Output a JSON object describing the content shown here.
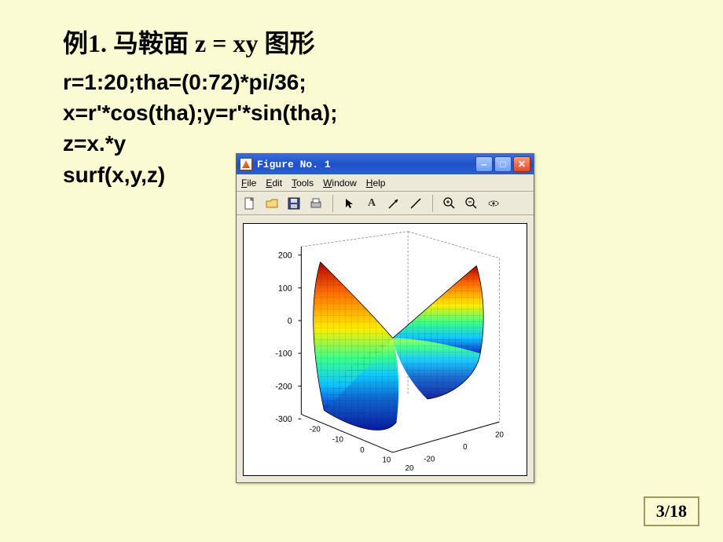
{
  "title": "例1. 马鞍面 z = xy 图形",
  "code": [
    "r=1:20;tha=(0:72)*pi/36;",
    "x=r'*cos(tha);y=r'*sin(tha);",
    "z=x.*y",
    "surf(x,y,z)"
  ],
  "figure": {
    "window_title": "Figure No. 1",
    "menus": {
      "file": "File",
      "edit": "Edit",
      "tools": "Tools",
      "window": "Window",
      "help": "Help"
    },
    "toolbar_icons": {
      "new": "new-file-icon",
      "open": "open-folder-icon",
      "save": "save-disk-icon",
      "print": "print-icon",
      "arrow": "pointer-arrow-icon",
      "text": "text-A-icon",
      "line_arrow": "arrow-icon",
      "line": "line-icon",
      "zoom_in": "zoom-in-icon",
      "zoom_out": "zoom-out-icon",
      "rotate": "rotate-3d-icon"
    },
    "z_ticks": [
      "200",
      "100",
      "0",
      "-100",
      "-200",
      "-300"
    ],
    "xy_ticks": [
      "-20",
      "-10",
      "0",
      "10",
      "20"
    ],
    "y_ticks_right": [
      "-20",
      "0",
      "20"
    ]
  },
  "page_number": "3/18",
  "chart_data": {
    "type": "surface-3d",
    "title": "",
    "equation": "z = x * y",
    "parameters": {
      "r_range": [
        1,
        20
      ],
      "theta_steps": 72,
      "theta_expr": "(0:72)*pi/36"
    },
    "axes": {
      "x": {
        "range": [
          -20,
          20
        ],
        "ticks": [
          -20,
          -10,
          0,
          10,
          20
        ]
      },
      "y": {
        "range": [
          -20,
          20
        ],
        "ticks": [
          -20,
          -10,
          0,
          10,
          20
        ]
      },
      "z": {
        "range": [
          -300,
          200
        ],
        "ticks": [
          -300,
          -200,
          -100,
          0,
          100,
          200
        ]
      }
    },
    "colormap": "jet",
    "grid": true,
    "note": "Saddle surface (hyperbolic paraboloid) plotted with MATLAB surf over a polar grid mapped to Cartesian; colors vary from blue (low z) to red (high z)."
  }
}
